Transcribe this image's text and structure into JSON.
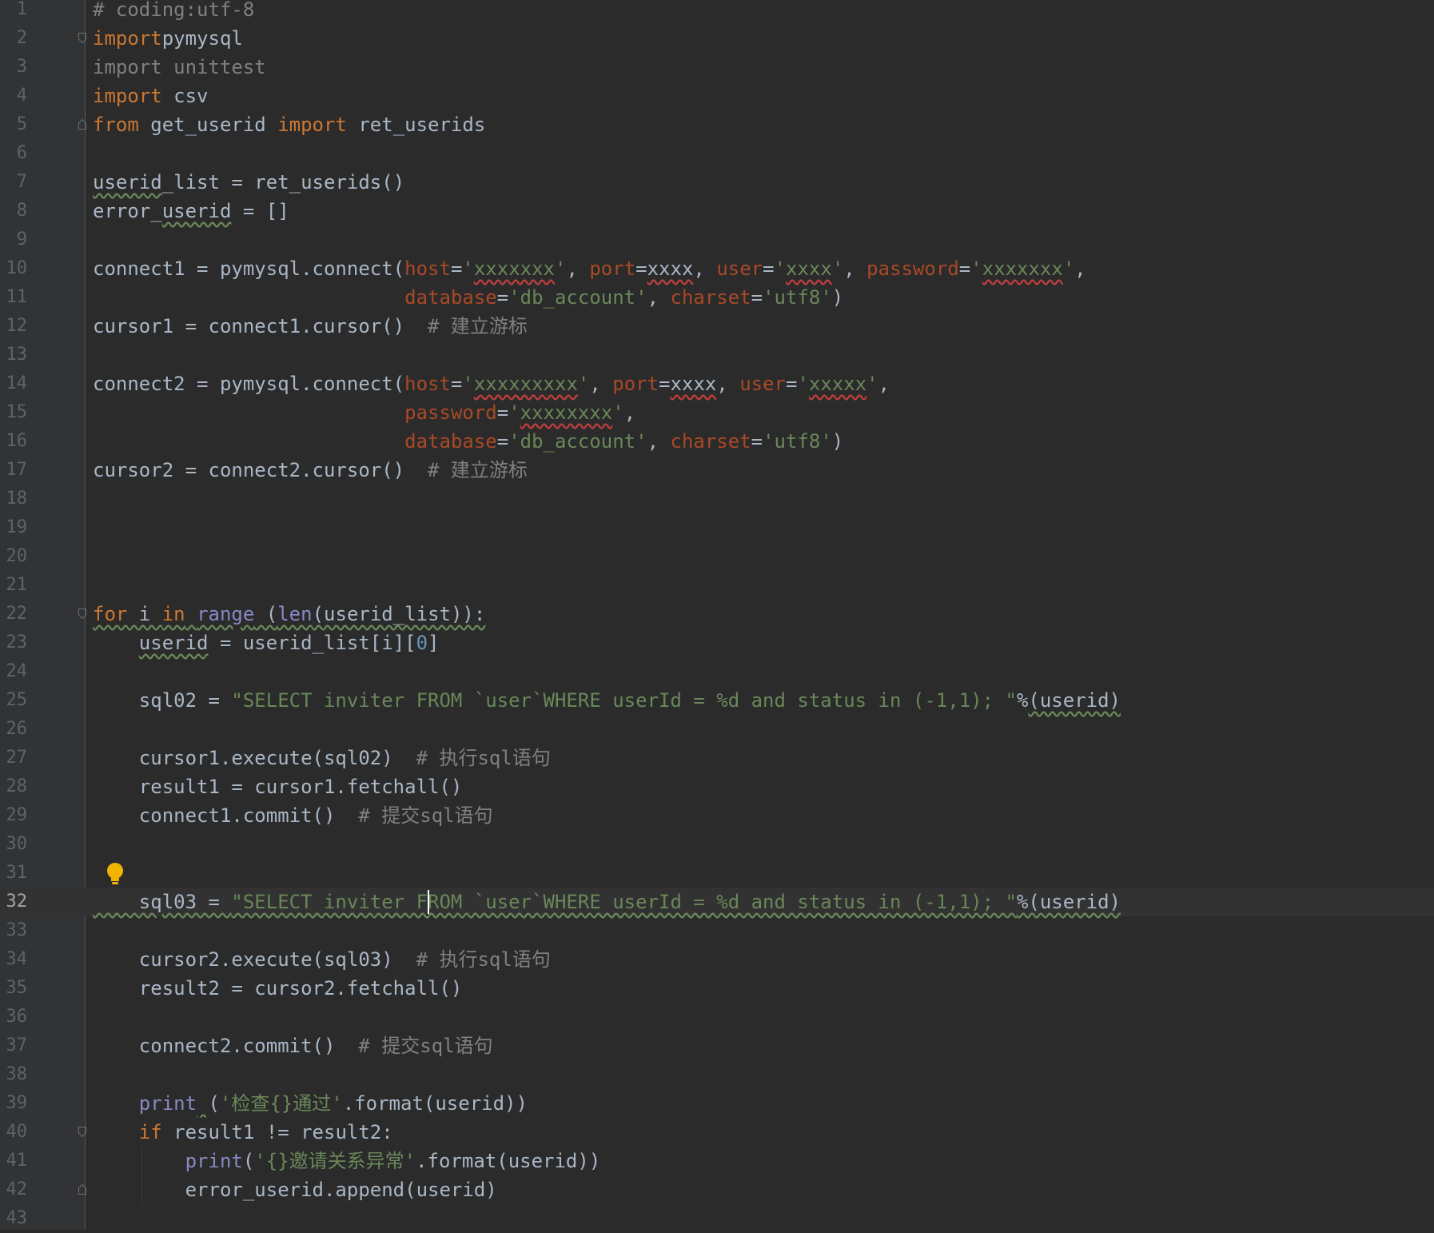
{
  "editor": {
    "language": "python",
    "current_line": 32,
    "colors": {
      "background": "#2b2b2b",
      "gutter": "#313335",
      "keyword": "#cc7832",
      "string": "#6a8759",
      "comment": "#808080",
      "param": "#aa4926",
      "builtin": "#8888c6",
      "number": "#6897bb",
      "plain": "#a9b7c6"
    },
    "lines": [
      {
        "n": "1",
        "t": [
          [
            "c",
            "# coding:utf-8"
          ]
        ]
      },
      {
        "n": "2",
        "t": [
          [
            "k",
            "import"
          ],
          [
            "",
            "pymysql"
          ]
        ],
        "fold": "open"
      },
      {
        "n": "3",
        "t": [
          [
            "d",
            "import unittest"
          ]
        ]
      },
      {
        "n": "4",
        "t": [
          [
            "k",
            "import"
          ],
          [
            "",
            " csv"
          ]
        ]
      },
      {
        "n": "5",
        "t": [
          [
            "k",
            "from"
          ],
          [
            "",
            " get_userid "
          ],
          [
            "k",
            "import"
          ],
          [
            "",
            " ret_userids"
          ]
        ],
        "fold": "close"
      },
      {
        "n": "6",
        "t": []
      },
      {
        "n": "7",
        "t": [
          [
            "w",
            "userid"
          ],
          [
            "",
            "_list = ret_userids()"
          ]
        ]
      },
      {
        "n": "8",
        "t": [
          [
            "",
            "error_"
          ],
          [
            "w",
            "userid"
          ],
          [
            "",
            " = []"
          ]
        ]
      },
      {
        "n": "9",
        "t": []
      },
      {
        "n": "10",
        "t": [
          [
            "",
            "connect1 = pymysql.connect("
          ],
          [
            "p",
            "host"
          ],
          [
            "",
            "="
          ],
          [
            "s",
            "'"
          ],
          [
            "se",
            "xxxxxxx"
          ],
          [
            "s",
            "'"
          ],
          [
            "",
            ", "
          ],
          [
            "p",
            "port"
          ],
          [
            "",
            "="
          ],
          [
            "e",
            "xxxx"
          ],
          [
            "",
            ", "
          ],
          [
            "p",
            "user"
          ],
          [
            "",
            "="
          ],
          [
            "s",
            "'"
          ],
          [
            "se",
            "xxxx"
          ],
          [
            "s",
            "'"
          ],
          [
            "",
            ", "
          ],
          [
            "p",
            "password"
          ],
          [
            "",
            "="
          ],
          [
            "s",
            "'"
          ],
          [
            "se",
            "xxxxxxx"
          ],
          [
            "s",
            "'"
          ],
          [
            "",
            ","
          ]
        ]
      },
      {
        "n": "11",
        "t": [
          [
            "",
            "                           "
          ],
          [
            "p",
            "database"
          ],
          [
            "",
            "="
          ],
          [
            "s",
            "'db_account'"
          ],
          [
            "",
            ", "
          ],
          [
            "p",
            "charset"
          ],
          [
            "",
            "="
          ],
          [
            "s",
            "'utf8'"
          ],
          [
            "",
            ")"
          ]
        ]
      },
      {
        "n": "12",
        "t": [
          [
            "",
            "cursor1 = connect1.cursor()  "
          ],
          [
            "c",
            "# 建立游标"
          ]
        ]
      },
      {
        "n": "13",
        "t": []
      },
      {
        "n": "14",
        "t": [
          [
            "",
            "connect2 = pymysql.connect("
          ],
          [
            "p",
            "host"
          ],
          [
            "",
            "="
          ],
          [
            "s",
            "'"
          ],
          [
            "se",
            "xxxxxxxxx"
          ],
          [
            "s",
            "'"
          ],
          [
            "",
            ", "
          ],
          [
            "p",
            "port"
          ],
          [
            "",
            "="
          ],
          [
            "e",
            "xxxx"
          ],
          [
            "",
            ", "
          ],
          [
            "p",
            "user"
          ],
          [
            "",
            "="
          ],
          [
            "s",
            "'"
          ],
          [
            "se",
            "xxxxx"
          ],
          [
            "s",
            "'"
          ],
          [
            "",
            ","
          ]
        ]
      },
      {
        "n": "15",
        "t": [
          [
            "",
            "                           "
          ],
          [
            "p",
            "password"
          ],
          [
            "",
            "="
          ],
          [
            "s",
            "'"
          ],
          [
            "se",
            "xxxxxxxx"
          ],
          [
            "s",
            "'"
          ],
          [
            "",
            ","
          ]
        ]
      },
      {
        "n": "16",
        "t": [
          [
            "",
            "                           "
          ],
          [
            "p",
            "database"
          ],
          [
            "",
            "="
          ],
          [
            "s",
            "'db_account'"
          ],
          [
            "",
            ", "
          ],
          [
            "p",
            "charset"
          ],
          [
            "",
            "="
          ],
          [
            "s",
            "'utf8'"
          ],
          [
            "",
            ")"
          ]
        ]
      },
      {
        "n": "17",
        "t": [
          [
            "",
            "cursor2 = connect2.cursor()  "
          ],
          [
            "c",
            "# 建立游标"
          ]
        ]
      },
      {
        "n": "18",
        "t": []
      },
      {
        "n": "19",
        "t": []
      },
      {
        "n": "20",
        "t": []
      },
      {
        "n": "21",
        "t": []
      },
      {
        "n": "22",
        "t": [
          [
            "kw",
            "for"
          ],
          [
            "w",
            " i "
          ],
          [
            "kw",
            "in"
          ],
          [
            "w",
            " "
          ],
          [
            "bw",
            "range"
          ],
          [
            "w",
            " ("
          ],
          [
            "bw",
            "len"
          ],
          [
            "w",
            "(userid_list)):"
          ]
        ],
        "fold": "open"
      },
      {
        "n": "23",
        "t": [
          [
            "",
            "    "
          ],
          [
            "w",
            "userid"
          ],
          [
            "",
            " = userid_list[i]["
          ],
          [
            "n",
            "0"
          ],
          [
            "",
            "]"
          ]
        ]
      },
      {
        "n": "24",
        "t": []
      },
      {
        "n": "25",
        "t": [
          [
            "",
            "    sql02 = "
          ],
          [
            "s",
            "\"SELECT inviter FROM `user`WHERE userId = %d and status in (-1,1); \""
          ],
          [
            "",
            "%"
          ],
          [
            "w",
            "(userid)"
          ]
        ]
      },
      {
        "n": "26",
        "t": []
      },
      {
        "n": "27",
        "t": [
          [
            "",
            "    cursor1.execute(sql02)  "
          ],
          [
            "c",
            "# 执行sql语句"
          ]
        ]
      },
      {
        "n": "28",
        "t": [
          [
            "",
            "    result1 = cursor1.fetchall()"
          ]
        ]
      },
      {
        "n": "29",
        "t": [
          [
            "",
            "    connect1.commit()  "
          ],
          [
            "c",
            "# 提交sql语句"
          ]
        ]
      },
      {
        "n": "30",
        "t": []
      },
      {
        "n": "31",
        "t": [],
        "bulb": true
      },
      {
        "n": "32",
        "t": [
          [
            "w",
            "    sql03 = "
          ],
          [
            "sw",
            "\"SELECT inviter FROM `user`WHERE userId = %d and status in (-1,1); \""
          ],
          [
            "w",
            "%(userid)"
          ]
        ],
        "current": true
      },
      {
        "n": "33",
        "t": []
      },
      {
        "n": "34",
        "t": [
          [
            "",
            "    cursor2.execute(sql03)  "
          ],
          [
            "c",
            "# 执行sql语句"
          ]
        ]
      },
      {
        "n": "35",
        "t": [
          [
            "",
            "    result2 = cursor2.fetchall()"
          ]
        ]
      },
      {
        "n": "36",
        "t": []
      },
      {
        "n": "37",
        "t": [
          [
            "",
            "    connect2.commit()  "
          ],
          [
            "c",
            "# 提交sql语句"
          ]
        ]
      },
      {
        "n": "38",
        "t": []
      },
      {
        "n": "39",
        "t": [
          [
            "",
            "    "
          ],
          [
            "b",
            "print"
          ],
          [
            "w",
            " "
          ],
          [
            "",
            "("
          ],
          [
            "s",
            "'检查{}通过'"
          ],
          [
            "",
            ".format(userid))"
          ]
        ]
      },
      {
        "n": "40",
        "t": [
          [
            "",
            "    "
          ],
          [
            "k",
            "if"
          ],
          [
            "",
            " result1 != result2:"
          ]
        ],
        "fold": "open"
      },
      {
        "n": "41",
        "t": [
          [
            "",
            "        "
          ],
          [
            "b",
            "print"
          ],
          [
            "",
            "("
          ],
          [
            "s",
            "'{}邀请关系异常'"
          ],
          [
            "",
            ".format(userid))"
          ]
        ]
      },
      {
        "n": "42",
        "t": [
          [
            "",
            "        error_userid.append(userid)"
          ]
        ],
        "fold": "close"
      },
      {
        "n": "43",
        "t": []
      }
    ]
  }
}
